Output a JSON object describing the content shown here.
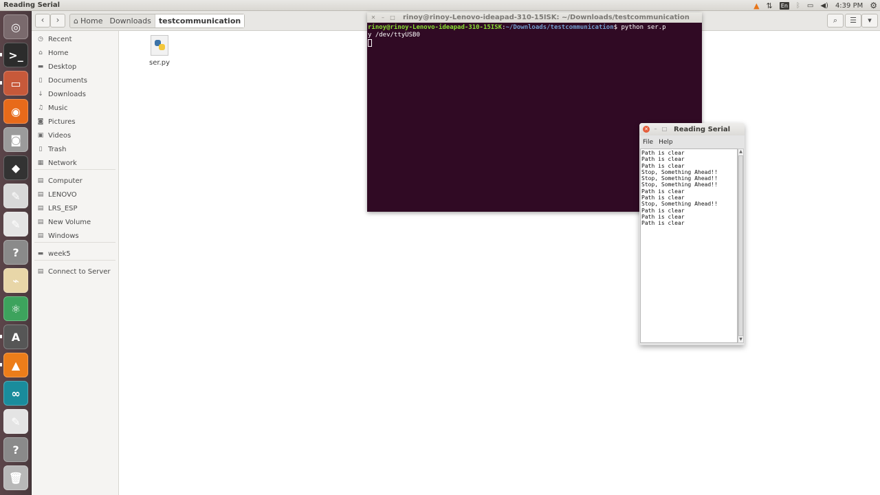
{
  "top_panel": {
    "title": "Reading Serial",
    "keyboard_layout": "En",
    "clock": "4:39 PM"
  },
  "launcher": {
    "items": [
      {
        "name": "dash-launcher",
        "icon": "ubuntu-logo-icon",
        "glyph": "◎",
        "color": "#7a6a6d"
      },
      {
        "name": "terminal-launcher",
        "icon": "terminal-icon",
        "glyph": ">_",
        "color": "#2c2c2c"
      },
      {
        "name": "files-launcher",
        "icon": "file-cabinet-icon",
        "glyph": "▭",
        "color": "#c7593a"
      },
      {
        "name": "firefox-launcher",
        "icon": "firefox-icon",
        "glyph": "◉",
        "color": "#e86a1a"
      },
      {
        "name": "camera-launcher",
        "icon": "camera-icon",
        "glyph": "◙",
        "color": "#9b9b9b"
      },
      {
        "name": "inkscape-launcher",
        "icon": "inkscape-icon",
        "glyph": "◆",
        "color": "#333333"
      },
      {
        "name": "editor-launcher",
        "icon": "pen-icon",
        "glyph": "✎",
        "color": "#d8d8d8"
      },
      {
        "name": "text-editor-launcher",
        "icon": "text-editor-icon",
        "glyph": "✎",
        "color": "#e4e4e4"
      },
      {
        "name": "unknown-launcher",
        "icon": "question-icon",
        "glyph": "?",
        "color": "#8a8a8a"
      },
      {
        "name": "fritzing-launcher",
        "icon": "circuit-icon",
        "glyph": "⌁",
        "color": "#e8d6a8"
      },
      {
        "name": "atom-launcher",
        "icon": "atom-icon",
        "glyph": "⚛",
        "color": "#3da35d"
      },
      {
        "name": "software-updater-launcher",
        "icon": "software-center-icon",
        "glyph": "A",
        "color": "#565656"
      },
      {
        "name": "vlc-launcher",
        "icon": "vlc-cone-icon",
        "glyph": "▲",
        "color": "#ec7d1a"
      },
      {
        "name": "arduino-launcher",
        "icon": "arduino-icon",
        "glyph": "∞",
        "color": "#1a8c9c"
      },
      {
        "name": "text-editor-2-launcher",
        "icon": "text-editor-icon",
        "glyph": "✎",
        "color": "#e4e4e4"
      },
      {
        "name": "unknown-2-launcher",
        "icon": "question-icon",
        "glyph": "?",
        "color": "#8a8a8a"
      },
      {
        "name": "trash-launcher",
        "icon": "trash-icon",
        "glyph": "🗑",
        "color": "#b8b8b8"
      }
    ]
  },
  "file_manager": {
    "breadcrumbs": [
      "Home",
      "Downloads",
      "testcommunication"
    ],
    "sidebar": [
      {
        "label": "Recent",
        "icon": "clock-icon",
        "glyph": "◷"
      },
      {
        "label": "Home",
        "icon": "home-icon",
        "glyph": "⌂"
      },
      {
        "label": "Desktop",
        "icon": "folder-icon",
        "glyph": "▬"
      },
      {
        "label": "Documents",
        "icon": "document-icon",
        "glyph": "▯"
      },
      {
        "label": "Downloads",
        "icon": "download-icon",
        "glyph": "↓"
      },
      {
        "label": "Music",
        "icon": "music-icon",
        "glyph": "♫"
      },
      {
        "label": "Pictures",
        "icon": "camera-icon",
        "glyph": "◙"
      },
      {
        "label": "Videos",
        "icon": "film-icon",
        "glyph": "▣"
      },
      {
        "label": "Trash",
        "icon": "trash-icon",
        "glyph": "▯"
      },
      {
        "label": "Network",
        "icon": "network-icon",
        "glyph": "▦"
      },
      {
        "label": "Computer",
        "icon": "drive-icon",
        "glyph": "▤"
      },
      {
        "label": "LENOVO",
        "icon": "drive-icon",
        "glyph": "▤"
      },
      {
        "label": "LRS_ESP",
        "icon": "drive-icon",
        "glyph": "▤"
      },
      {
        "label": "New Volume",
        "icon": "drive-icon",
        "glyph": "▤"
      },
      {
        "label": "Windows",
        "icon": "drive-icon",
        "glyph": "▤"
      },
      {
        "label": "week5",
        "icon": "folder-icon",
        "glyph": "▬"
      },
      {
        "label": "Connect to Server",
        "icon": "server-icon",
        "glyph": "▤"
      }
    ],
    "files": [
      {
        "name": "ser.py",
        "icon": "python-file-icon"
      }
    ]
  },
  "terminal": {
    "title": "rinoy@rinoy-Lenovo-ideapad-310-15ISK: ~/Downloads/testcommunication",
    "prompt_user": "rinoy@rinoy-Lenovo-ideapad-310-15ISK",
    "prompt_colon": ":",
    "prompt_path": "~/Downloads/testcommunication",
    "prompt_dollar": "$ ",
    "command_line1": "python ser.p",
    "command_line2": "y /dev/ttyUSB0"
  },
  "serial_window": {
    "title": "Reading Serial",
    "menu": [
      "File",
      "Help"
    ],
    "lines": [
      "Path is clear",
      "Path is clear",
      "Path is clear",
      "Stop, Something Ahead!!",
      "Stop, Something Ahead!!",
      "Stop, Something Ahead!!",
      "Path is clear",
      "Path is clear",
      "Stop, Something Ahead!!",
      "Path is clear",
      "Path is clear",
      "Path is clear"
    ]
  }
}
